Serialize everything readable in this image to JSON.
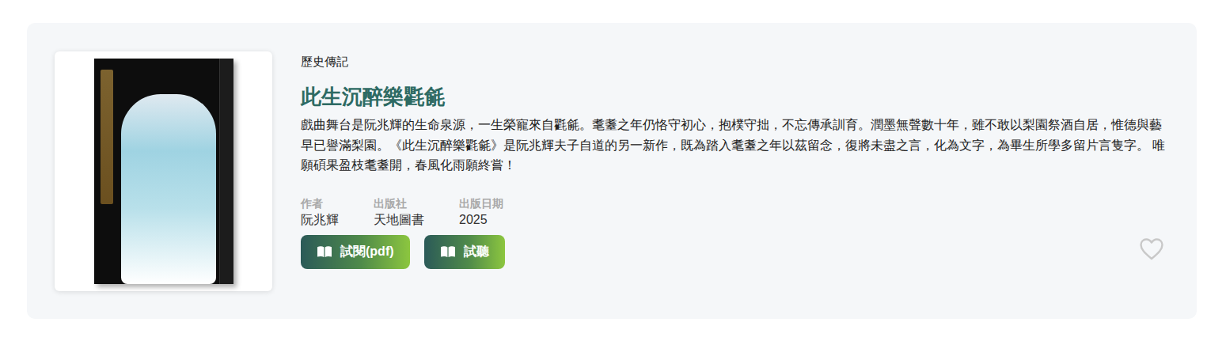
{
  "listing": {
    "category": "歷史傳記",
    "title": "此生沉醉樂氍毹",
    "description": "戲曲舞台是阮兆輝的生命泉源，一生榮寵來自氍毹。耄耋之年仍恪守初心，抱樸守拙，不忘傳承訓育。潤墨無聲數十年，雖不敢以梨園祭酒自居，惟德與藝早已譽滿梨園。《此生沉醉樂氍毹》是阮兆輝夫子自道的另一新作，既為踏入耄耋之年以茲留念，復將未盡之言，化為文字，為畢生所學多留片言隻字。 唯願碩果盈枝耄耋開，春風化雨願終嘗！",
    "meta": [
      {
        "label": "作者",
        "value": "阮兆輝"
      },
      {
        "label": "出版社",
        "value": "天地圖書"
      },
      {
        "label": "出版日期",
        "value": "2025"
      }
    ],
    "buttons": [
      {
        "label": "試閱(pdf)"
      },
      {
        "label": "試聽"
      }
    ],
    "favorite": {
      "selected": false
    }
  }
}
